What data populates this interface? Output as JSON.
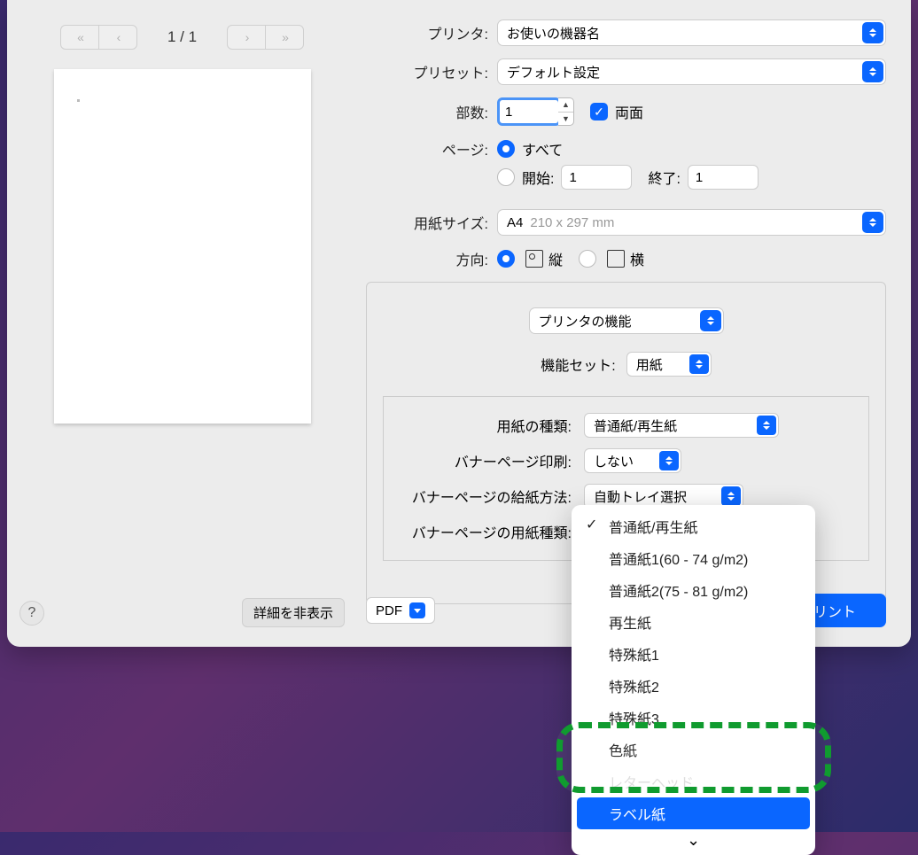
{
  "preview": {
    "page_indicator": "1 / 1"
  },
  "labels": {
    "printer": "プリンタ:",
    "preset": "プリセット:",
    "copies": "部数:",
    "duplex": "両面",
    "pages": "ページ:",
    "all": "すべて",
    "from": "開始:",
    "to": "終了:",
    "paper_size": "用紙サイズ:",
    "orientation": "方向:",
    "portrait": "縦",
    "landscape": "横",
    "feature_set": "機能セット:",
    "paper_type": "用紙の種類:",
    "banner_print": "バナーページ印刷:",
    "banner_tray": "バナーページの給紙方法:",
    "banner_paper": "バナーページの用紙種類:"
  },
  "values": {
    "printer": "お使いの機器名",
    "preset": "デフォルト設定",
    "copies": "1",
    "from": "1",
    "to": "1",
    "paper_size_name": "A4",
    "paper_size_dim": "210 x 297 mm",
    "panel": "プリンタの機能",
    "feature_set": "用紙",
    "paper_type": "普通紙/再生紙",
    "banner_print": "しない",
    "banner_tray": "自動トレイ選択"
  },
  "buttons": {
    "hide_details": "詳細を非表示",
    "help": "?",
    "pdf": "PDF",
    "print": "プリント"
  },
  "menu": {
    "items": [
      "普通紙/再生紙",
      "普通紙1(60 - 74 g/m2)",
      "普通紙2(75 - 81 g/m2)",
      "再生紙",
      "特殊紙1",
      "特殊紙2",
      "特殊紙3",
      "色紙",
      "レターヘッド",
      "ラベル紙"
    ],
    "checked_index": 0,
    "selected_index": 9
  }
}
